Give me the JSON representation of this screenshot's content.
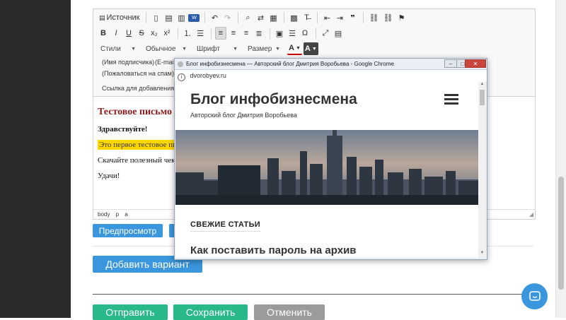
{
  "editor": {
    "toolbar": {
      "source_label": "Источник",
      "combos": [
        "Стили",
        "Обычное",
        "Шрифт",
        "Размер"
      ],
      "merge_fields": [
        "(Имя подписчика)",
        "(E-mail",
        "(Пожаловаться на спам)",
        "Ссылка для добавления/удал"
      ]
    },
    "content": {
      "title": "Тестовое письмо",
      "greeting": "Здравствуйте!",
      "line1": "Это первое тестовое пи",
      "line2": "Скачайте полезный чек л",
      "closing": "Удачи!"
    },
    "statusbar": [
      "body",
      "p",
      "a"
    ]
  },
  "buttons": {
    "preview": "Предпросмотр",
    "add_variant": "Добавить вариант",
    "send": "Отправить",
    "save": "Сохранить",
    "cancel": "Отменить"
  },
  "popup": {
    "window_title": "Блог инфобизнесмена — Авторский блог Дмитрия Воробьева - Google Chrome",
    "address": "dvorobyev.ru",
    "blog_title": "Блог инфобизнесмена",
    "blog_subtitle": "Авторский блог Дмитрия Воробьева",
    "section_title": "СВЕЖИЕ СТАТЬИ",
    "post_title": "Как поставить пароль на архив"
  },
  "colors": {
    "accent_blue": "#3a96dd",
    "green": "#28b88a",
    "grey": "#9b9b9b",
    "title_red": "#8b1a1a",
    "highlight": "#ffd700"
  },
  "icons": {
    "chat": "chat-bubble-icon",
    "close": "close-icon",
    "menu": "hamburger-icon"
  }
}
